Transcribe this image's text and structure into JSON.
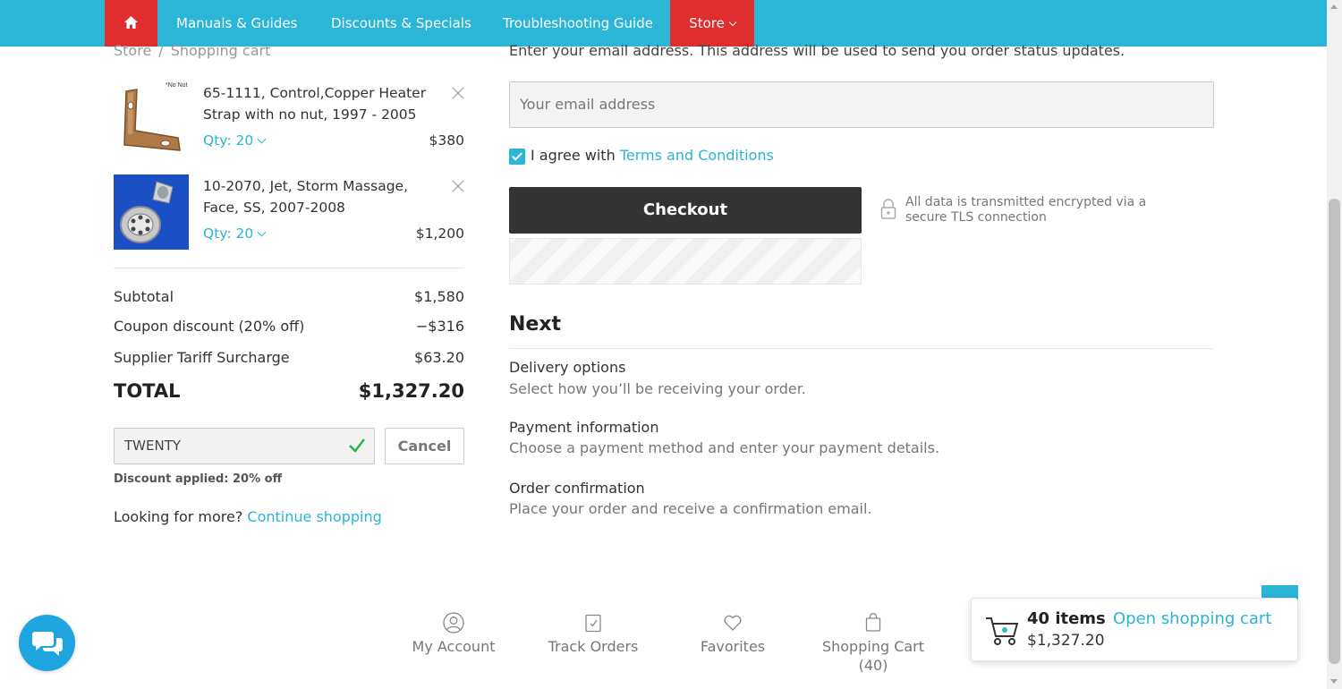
{
  "nav": {
    "home_icon": "home-icon",
    "items": [
      "Manuals & Guides",
      "Discounts & Specials",
      "Troubleshooting Guide"
    ],
    "store": "Store"
  },
  "breadcrumb": {
    "root": "Store",
    "sep": "/",
    "current": "Shopping cart"
  },
  "cart": {
    "items": [
      {
        "name": "65-1111, Control,Copper Heater Strap with no nut, 1997 - 2005",
        "qty": "Qty: 20",
        "price": "$380",
        "thumb_note": "*No Nut"
      },
      {
        "name": "10-2070, Jet, Storm Massage, Face, SS, 2007-2008",
        "qty": "Qty: 20",
        "price": "$1,200"
      }
    ],
    "remove_icon": "close-icon"
  },
  "summary": {
    "subtotal_label": "Subtotal",
    "subtotal": "$1,580",
    "coupon_label": "Coupon discount (20% off)",
    "coupon": "−$316",
    "tariff_label": "Supplier Tariff Surcharge",
    "tariff": "$63.20",
    "total_label": "TOTAL",
    "total": "$1,327.20"
  },
  "coupon": {
    "value": "TWENTY",
    "cancel": "Cancel",
    "note": "Discount applied: 20% off"
  },
  "more": {
    "text": "Looking for more?",
    "link": "Continue shopping"
  },
  "checkout": {
    "email_prompt": "Enter your email address. This address will be used to send you order status updates.",
    "email_placeholder": "Your email address",
    "agree_text": "I agree with",
    "agree_link": "Terms and Conditions",
    "button": "Checkout",
    "secure_text": "All data is transmitted encrypted via a secure TLS connection"
  },
  "next": {
    "heading": "Next",
    "steps": [
      {
        "title": "Delivery options",
        "desc": "Select how you’ll be receiving your order."
      },
      {
        "title": "Payment information",
        "desc": "Choose a payment method and enter your payment details."
      },
      {
        "title": "Order confirmation",
        "desc": "Place your order and receive a confirmation email."
      }
    ]
  },
  "footer": {
    "account": "My Account",
    "track": "Track Orders",
    "favorites": "Favorites",
    "cart": "Shopping Cart",
    "cart_count": "(40)"
  },
  "mini_cart": {
    "count": "40 items",
    "total": "$1,327.20",
    "link": "Open shopping cart"
  },
  "colors": {
    "accent": "#2bb5d6",
    "nav_red": "#e02d2d",
    "dark_button": "#333333",
    "success": "#2bb14a"
  }
}
